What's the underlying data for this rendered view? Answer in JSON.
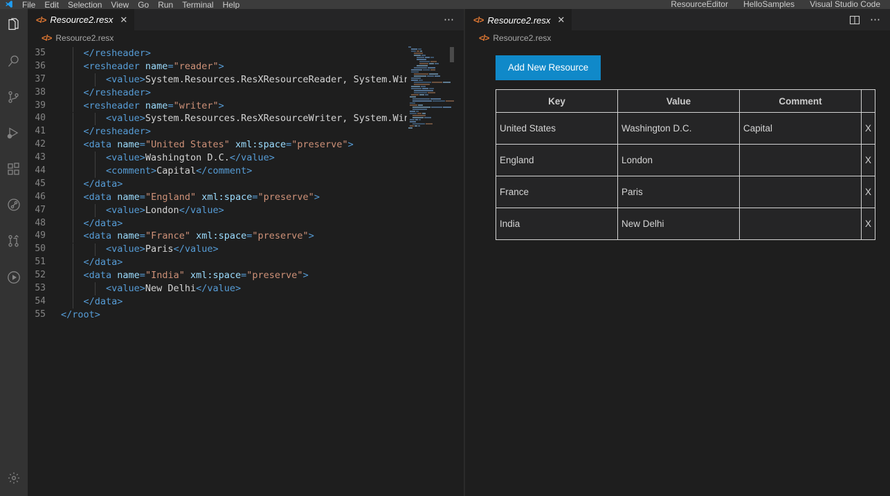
{
  "titlebar": {
    "menus": [
      "File",
      "Edit",
      "Selection",
      "View",
      "Go",
      "Run",
      "Terminal",
      "Help"
    ],
    "right_items": [
      "ResourceEditor",
      "HelloSamples",
      "Visual Studio Code"
    ]
  },
  "activitybar": {
    "items": [
      {
        "name": "explorer-icon",
        "label": "Explorer"
      },
      {
        "name": "search-icon",
        "label": "Search"
      },
      {
        "name": "source-control-icon",
        "label": "Source Control"
      },
      {
        "name": "run-and-debug-icon",
        "label": "Run and Debug"
      },
      {
        "name": "extensions-icon",
        "label": "Extensions"
      },
      {
        "name": "timeline-icon",
        "label": "Timeline"
      },
      {
        "name": "pull-request-icon",
        "label": "Pull Requests"
      },
      {
        "name": "run-icon",
        "label": "Run"
      }
    ],
    "bottom": [
      {
        "name": "settings-gear-icon",
        "label": "Manage"
      }
    ]
  },
  "left_editor": {
    "tab": {
      "label": "Resource2.resx",
      "icon": "xml-file-icon",
      "close": "✕"
    },
    "actions": {
      "more": "⋯"
    },
    "breadcrumb": {
      "label": "Resource2.resx",
      "icon": "xml-file-icon"
    },
    "lines": [
      {
        "num": "35",
        "indent": 1,
        "tokens": [
          {
            "t": "tag",
            "s": "    </resheader>"
          }
        ]
      },
      {
        "num": "36",
        "indent": 1,
        "tokens": [
          {
            "t": "tag",
            "s": "    <resheader "
          },
          {
            "t": "attr",
            "s": "name"
          },
          {
            "t": "tag",
            "s": "="
          },
          {
            "t": "str",
            "s": "\"reader\""
          },
          {
            "t": "tag",
            "s": ">"
          }
        ]
      },
      {
        "num": "37",
        "indent": 2,
        "tokens": [
          {
            "t": "tag",
            "s": "        <value>"
          },
          {
            "t": "txt",
            "s": "System.Resources.ResXResourceReader, System.Win"
          }
        ]
      },
      {
        "num": "38",
        "indent": 1,
        "tokens": [
          {
            "t": "tag",
            "s": "    </resheader>"
          }
        ]
      },
      {
        "num": "39",
        "indent": 1,
        "tokens": [
          {
            "t": "tag",
            "s": "    <resheader "
          },
          {
            "t": "attr",
            "s": "name"
          },
          {
            "t": "tag",
            "s": "="
          },
          {
            "t": "str",
            "s": "\"writer\""
          },
          {
            "t": "tag",
            "s": ">"
          }
        ]
      },
      {
        "num": "40",
        "indent": 2,
        "tokens": [
          {
            "t": "tag",
            "s": "        <value>"
          },
          {
            "t": "txt",
            "s": "System.Resources.ResXResourceWriter, System.Win"
          }
        ]
      },
      {
        "num": "41",
        "indent": 1,
        "tokens": [
          {
            "t": "tag",
            "s": "    </resheader>"
          }
        ]
      },
      {
        "num": "42",
        "indent": 1,
        "tokens": [
          {
            "t": "tag",
            "s": "    <data "
          },
          {
            "t": "attr",
            "s": "name"
          },
          {
            "t": "tag",
            "s": "="
          },
          {
            "t": "str",
            "s": "\"United States\""
          },
          {
            "t": "tag",
            "s": " "
          },
          {
            "t": "attr",
            "s": "xml:space"
          },
          {
            "t": "tag",
            "s": "="
          },
          {
            "t": "str",
            "s": "\"preserve\""
          },
          {
            "t": "tag",
            "s": ">"
          }
        ]
      },
      {
        "num": "43",
        "indent": 2,
        "tokens": [
          {
            "t": "tag",
            "s": "        <value>"
          },
          {
            "t": "txt",
            "s": "Washington D.C."
          },
          {
            "t": "tag",
            "s": "</value>"
          }
        ]
      },
      {
        "num": "44",
        "indent": 2,
        "tokens": [
          {
            "t": "tag",
            "s": "        <comment>"
          },
          {
            "t": "txt",
            "s": "Capital"
          },
          {
            "t": "tag",
            "s": "</comment>"
          }
        ]
      },
      {
        "num": "45",
        "indent": 1,
        "tokens": [
          {
            "t": "tag",
            "s": "    </data>"
          }
        ]
      },
      {
        "num": "46",
        "indent": 1,
        "tokens": [
          {
            "t": "tag",
            "s": "    <data "
          },
          {
            "t": "attr",
            "s": "name"
          },
          {
            "t": "tag",
            "s": "="
          },
          {
            "t": "str",
            "s": "\"England\""
          },
          {
            "t": "tag",
            "s": " "
          },
          {
            "t": "attr",
            "s": "xml:space"
          },
          {
            "t": "tag",
            "s": "="
          },
          {
            "t": "str",
            "s": "\"preserve\""
          },
          {
            "t": "tag",
            "s": ">"
          }
        ]
      },
      {
        "num": "47",
        "indent": 2,
        "tokens": [
          {
            "t": "tag",
            "s": "        <value>"
          },
          {
            "t": "txt",
            "s": "London"
          },
          {
            "t": "tag",
            "s": "</value>"
          }
        ]
      },
      {
        "num": "48",
        "indent": 1,
        "tokens": [
          {
            "t": "tag",
            "s": "    </data>"
          }
        ]
      },
      {
        "num": "49",
        "indent": 1,
        "tokens": [
          {
            "t": "tag",
            "s": "    <data "
          },
          {
            "t": "attr",
            "s": "name"
          },
          {
            "t": "tag",
            "s": "="
          },
          {
            "t": "str",
            "s": "\"France\""
          },
          {
            "t": "tag",
            "s": " "
          },
          {
            "t": "attr",
            "s": "xml:space"
          },
          {
            "t": "tag",
            "s": "="
          },
          {
            "t": "str",
            "s": "\"preserve\""
          },
          {
            "t": "tag",
            "s": ">"
          }
        ]
      },
      {
        "num": "50",
        "indent": 2,
        "tokens": [
          {
            "t": "tag",
            "s": "        <value>"
          },
          {
            "t": "txt",
            "s": "Paris"
          },
          {
            "t": "tag",
            "s": "</value>"
          }
        ]
      },
      {
        "num": "51",
        "indent": 1,
        "tokens": [
          {
            "t": "tag",
            "s": "    </data>"
          }
        ]
      },
      {
        "num": "52",
        "indent": 1,
        "tokens": [
          {
            "t": "tag",
            "s": "    <data "
          },
          {
            "t": "attr",
            "s": "name"
          },
          {
            "t": "tag",
            "s": "="
          },
          {
            "t": "str",
            "s": "\"India\""
          },
          {
            "t": "tag",
            "s": " "
          },
          {
            "t": "attr",
            "s": "xml:space"
          },
          {
            "t": "tag",
            "s": "="
          },
          {
            "t": "str",
            "s": "\"preserve\""
          },
          {
            "t": "tag",
            "s": ">"
          }
        ]
      },
      {
        "num": "53",
        "indent": 2,
        "tokens": [
          {
            "t": "tag",
            "s": "        <value>"
          },
          {
            "t": "txt",
            "s": "New Delhi"
          },
          {
            "t": "tag",
            "s": "</value>"
          }
        ]
      },
      {
        "num": "54",
        "indent": 1,
        "tokens": [
          {
            "t": "tag",
            "s": "    </data>"
          }
        ]
      },
      {
        "num": "55",
        "indent": 0,
        "tokens": [
          {
            "t": "tag",
            "s": "</root>"
          }
        ]
      }
    ]
  },
  "right_editor": {
    "tab": {
      "label": "Resource2.resx",
      "icon": "xml-file-icon",
      "close": "✕"
    },
    "actions": {
      "split": "split-editor-icon",
      "more": "⋯"
    },
    "breadcrumb": {
      "label": "Resource2.resx",
      "icon": "xml-file-icon"
    },
    "add_button": {
      "label": "Add New Resource"
    },
    "table": {
      "headers": [
        "Key",
        "Value",
        "Comment",
        ""
      ],
      "delete_label": "X",
      "rows": [
        {
          "key": "United States",
          "value": "Washington D.C.",
          "comment": "Capital"
        },
        {
          "key": "England",
          "value": "London",
          "comment": ""
        },
        {
          "key": "France",
          "value": "Paris",
          "comment": ""
        },
        {
          "key": "India",
          "value": "New Delhi",
          "comment": ""
        }
      ]
    }
  },
  "colors": {
    "accent_blue": "#1089c9",
    "editor_bg": "#1e1e1e",
    "tabbar_bg": "#252526",
    "activitybar_bg": "#333333",
    "titlebar_bg": "#3c3c3c",
    "tag": "#569cd6",
    "attr": "#9cdcfe",
    "string": "#ce9178",
    "text": "#d4d4d4",
    "xml_icon": "#e37933"
  }
}
